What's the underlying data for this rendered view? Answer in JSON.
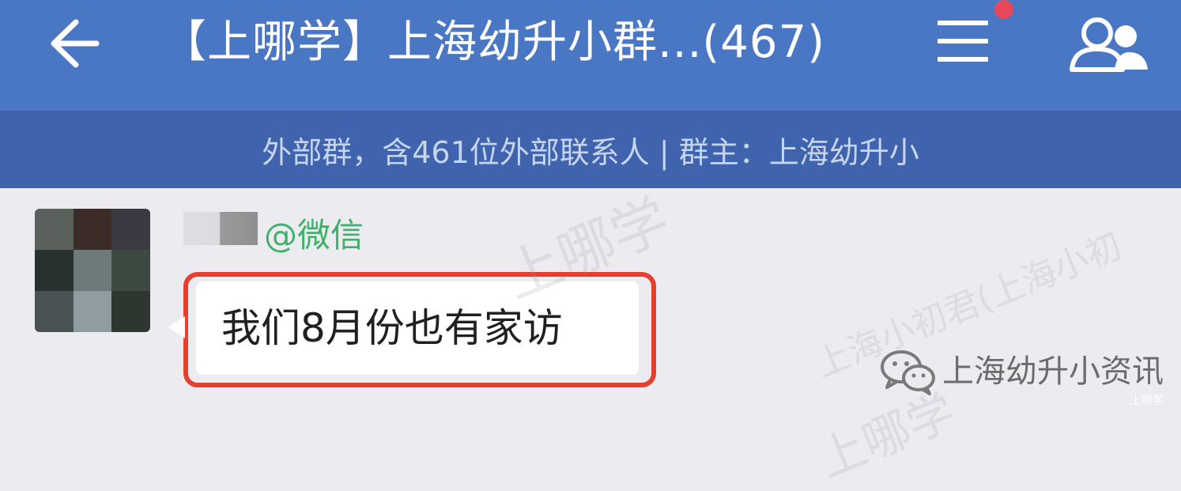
{
  "header": {
    "back_icon": "arrow-left-icon",
    "title": "【上哪学】上海幼升小群...(467)",
    "menu_icon": "hamburger-menu-icon",
    "members_icon": "group-members-icon",
    "notification_dot_color": "#e8485a"
  },
  "subheader": {
    "text": "外部群，含461位外部联系人 | 群主：上海幼升小"
  },
  "message": {
    "sender_tag": "@微信",
    "text": "我们8月份也有家访",
    "highlight_color": "#e3412d"
  },
  "footer": {
    "account_icon": "wechat-logo-icon",
    "account_name": "上海幼升小资讯",
    "corner_mark": "上哪学"
  },
  "watermarks": {
    "brand": "上哪学",
    "account": "上海小初君(上海小初"
  },
  "colors": {
    "topbar": "#4a77c4",
    "subbar": "#3f64ad",
    "chat_background": "#ebebf0",
    "sender_tag": "#3eb26a"
  }
}
